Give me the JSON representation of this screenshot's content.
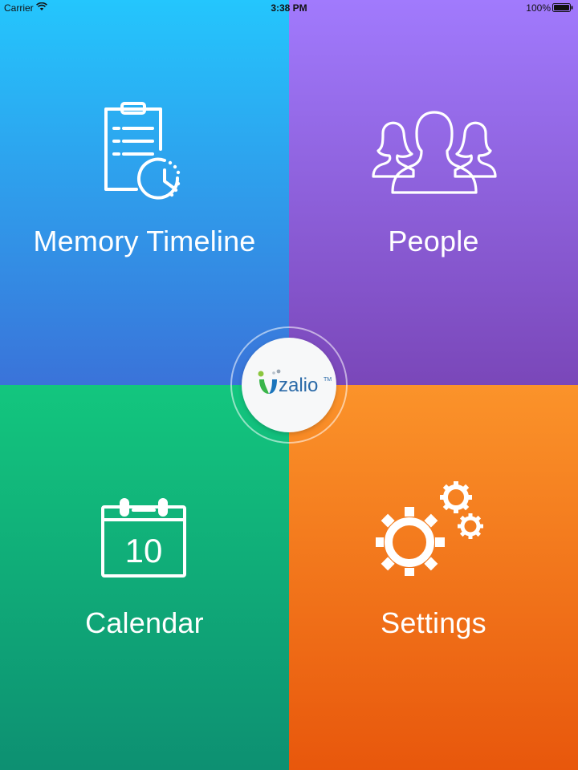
{
  "status_bar": {
    "carrier": "Carrier",
    "time": "3:38 PM",
    "battery": "100%"
  },
  "tiles": {
    "memory_timeline": {
      "label": "Memory Timeline",
      "color_top": "#24c6fd",
      "color_bottom": "#3a73d9",
      "icon": "clipboard-clock-icon"
    },
    "people": {
      "label": "People",
      "color_top": "#a17afd",
      "color_bottom": "#7a47b9",
      "icon": "people-group-icon"
    },
    "calendar": {
      "label": "Calendar",
      "day": "10",
      "color_top": "#13c67e",
      "color_bottom": "#0d9072",
      "icon": "calendar-icon"
    },
    "settings": {
      "label": "Settings",
      "color_top": "#fb932a",
      "color_bottom": "#e8570c",
      "icon": "gears-icon"
    }
  },
  "logo": {
    "brand": "zalio",
    "trademark": "TM"
  }
}
